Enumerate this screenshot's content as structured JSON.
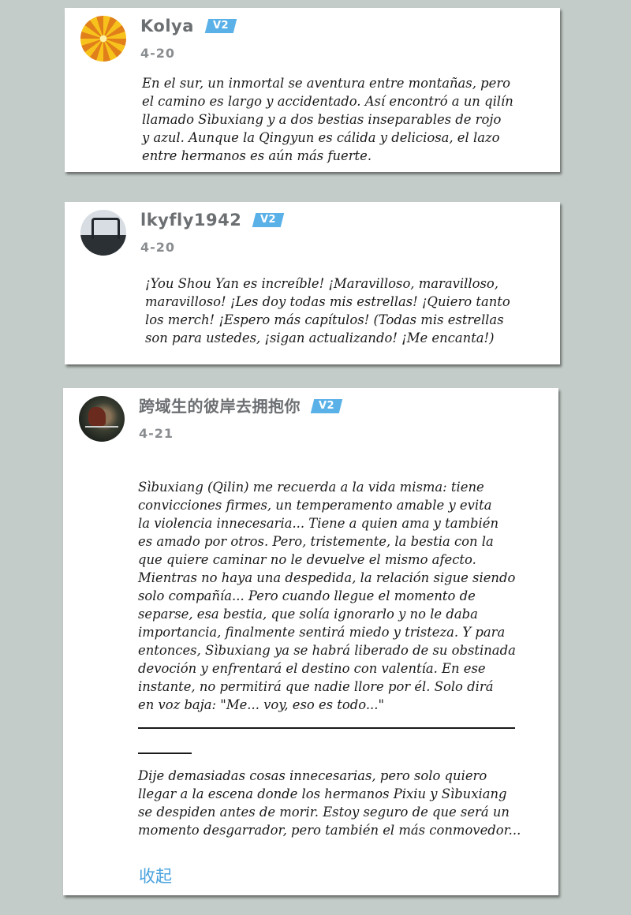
{
  "badge_label": "V2",
  "comments": [
    {
      "username": "Kolya",
      "date": "4-20",
      "avatar": "orange-star-avatar",
      "text": "En el sur, un inmortal se aventura entre montañas, pero\nel camino es largo y accidentado. Así encontró a un qilín\nllamado Sìbuxiang y a dos bestias inseparables de rojo\ny azul. Aunque la Qingyun es cálida y deliciosa, el lazo\nentre hermanos es aún más fuerte."
    },
    {
      "username": "lkyfly1942",
      "date": "4-20",
      "avatar": "bridge-photo-avatar",
      "text": "¡You Shou Yan es increíble! ¡Maravilloso, maravilloso,\nmaravilloso! ¡Les doy todas mis estrellas! ¡Quiero tanto\nlos merch! ¡Espero más capítulos! (Todas mis estrellas\nson para ustedes, ¡sigan actualizando! ¡Me encanta!)"
    },
    {
      "username": "跨域生的彼岸去拥抱你",
      "date": "4-21",
      "avatar": "dark-photo-avatar",
      "text": "Sìbuxiang (Qilin) me recuerda a la vida misma: tiene\nconvicciones firmes, un temperamento amable y evita\nla violencia innecesaria... Tiene a quien ama y también\nes amado por otros. Pero, tristemente, la bestia con la\nque quiere caminar no le devuelve el mismo afecto.\nMientras no haya una despedida, la relación sigue siendo\nsolo compañía... Pero cuando llegue el momento de\nseparse, esa bestia, que solía ignorarlo y no le daba\nimportancia, finalmente sentirá miedo y tristeza. Y para\nentonces, Sìbuxiang ya se habrá liberado de su obstinada\ndevoción y enfrentará el destino con valentía. En ese\ninstante, no permitirá que nadie llore por él. Solo dirá\nen voz baja: \"Me... voy, eso es todo...\"",
      "text_2": "Dije demasiadas cosas innecesarias, pero solo quiero\nllegar a la escena donde los hermanos Pixiu y Sìbuxiang\nse despiden antes de morir. Estoy seguro de que será un\nmomento desgarrador, pero también el más conmovedor...",
      "collapse_label": "收起"
    }
  ]
}
